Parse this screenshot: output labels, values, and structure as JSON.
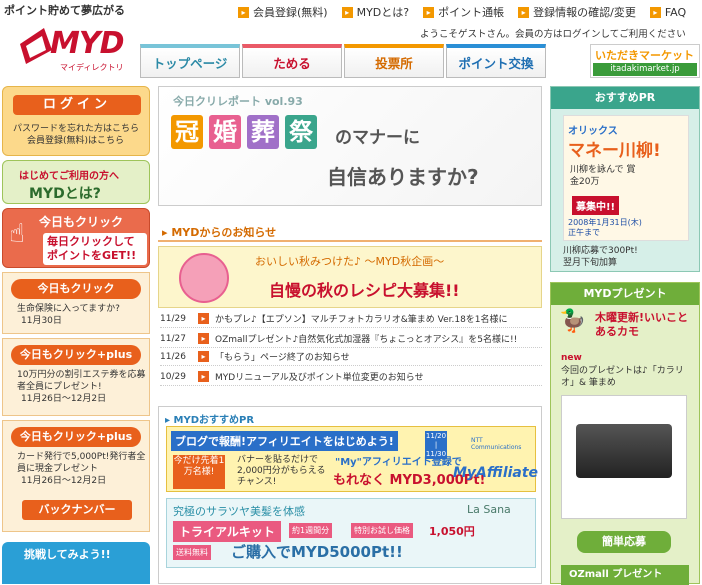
{
  "header": {
    "tagline": "ポイント貯めて夢広がる",
    "logo_main": "MYD",
    "logo_sub": "マイディレクトリ",
    "links": [
      "会員登録(無料)",
      "MYDとは?",
      "ポイント通帳",
      "登録情報の確認/変更",
      "FAQ"
    ],
    "welcome": "ようこそゲストさん。会員の方はログインしてご利用ください",
    "nav": [
      "トップページ",
      "ためる",
      "投票所",
      "ポイント交換"
    ],
    "itadaki_title": "いただきマーケット",
    "itadaki_url": "itadakimarket.jp"
  },
  "left": {
    "login_button": "ログイン",
    "forgot_pw": "パスワードを忘れた方はこちら",
    "register": "会員登録(無料)はこちら",
    "hajime_a": "はじめてご利用の方へ",
    "hajime_b": "MYDとは?",
    "kyomo_title": "今日もクリック",
    "kyomo_body": "毎日クリックしてポイントをGET!!",
    "click_items": [
      {
        "button": "今日もクリック",
        "text": "生命保険に入ってますか?",
        "date": "11月30日"
      },
      {
        "button": "今日もクリック+plus",
        "text": "10万円分の割引エステ券を応募者全員にプレゼント!",
        "date": "11月26日〜12月2日"
      },
      {
        "button": "今日もクリック+plus",
        "text": "カード発行で5,000Pt!発行者全員に現金プレゼント",
        "date": "11月26日〜12月2日"
      }
    ],
    "back_number": "バックナンバー",
    "challenge": "挑戦してみよう!!"
  },
  "center": {
    "banner1_vol": "今日クリレポート vol.93",
    "banner1_kanji": [
      "冠",
      "婚",
      "葬",
      "祭"
    ],
    "banner1_colors": [
      "#f39800",
      "#e86090",
      "#a070c8",
      "#3aa58c"
    ],
    "banner1_line1": "のマナーに",
    "banner1_line2": "自信ありますか?",
    "news_heading": "MYDからのお知らせ",
    "banner2_a": "おいしい秋みつけた♪ 〜MYD秋企画〜",
    "banner2_b": "自慢の秋のレシピ大募集!!",
    "news": [
      {
        "date": "11/29",
        "text": "かもプレ♪【エプソン】マルチフォトカラリオ&筆まめ Ver.18を1名様に"
      },
      {
        "date": "11/27",
        "text": "OZmallプレゼント♪自然気化式加湿器『ちょこっとオアシス』を5名様に!!"
      },
      {
        "date": "11/26",
        "text": "「もらう」ページ終了のお知らせ"
      },
      {
        "date": "10/29",
        "text": "MYDリニューアル及びポイント単位変更のお知らせ"
      }
    ],
    "pr_heading": "MYDおすすめPR",
    "aff_title": "ブログで報酬!アフィリエイトをはじめよう!",
    "aff_date": "11/20 | 11/30",
    "aff_badge": "今だけ先着1万名様!",
    "aff_note": "バナーを貼るだけで 2,000円分がもらえるチャンス!",
    "aff_reg": "\"My\"アフィリエイト登録で",
    "aff_pts": "もれなく MYD3,000Pt!",
    "aff_logo": "MyAffiliate",
    "aff_ntt": "NTT Communications",
    "lasana_a": "究極のサラツヤ美髪を体感",
    "lasana_b": "トライアルキット",
    "lasana_c": "約1週間分",
    "lasana_c2": "特別お試し価格",
    "lasana_price": "1,050円",
    "lasana_ship": "送料無料",
    "lasana_d": "ご購入でMYD5000Pt!!",
    "lasana_logo": "La Sana"
  },
  "right": {
    "pr_heading": "おすすめPR",
    "pr_a": "オリックス",
    "pr_b": "マネー川柳!",
    "pr_c": "川柳を詠んで 賞金20万",
    "pr_d": "募集中!!",
    "pr_e": "2008年1月31日(木)正午まで",
    "pr_t1": "川柳応募で300Pt!",
    "pr_t2": "翌月下旬加算",
    "present_heading": "MYDプレゼント",
    "present_a": "木曜更新!いいことあるカモ",
    "present_new": "new",
    "present_b": "今回のプレゼントは♪「カラリオ」& 筆まめ",
    "present_button": "簡単応募",
    "ozmall": "OZmall プレゼント"
  }
}
